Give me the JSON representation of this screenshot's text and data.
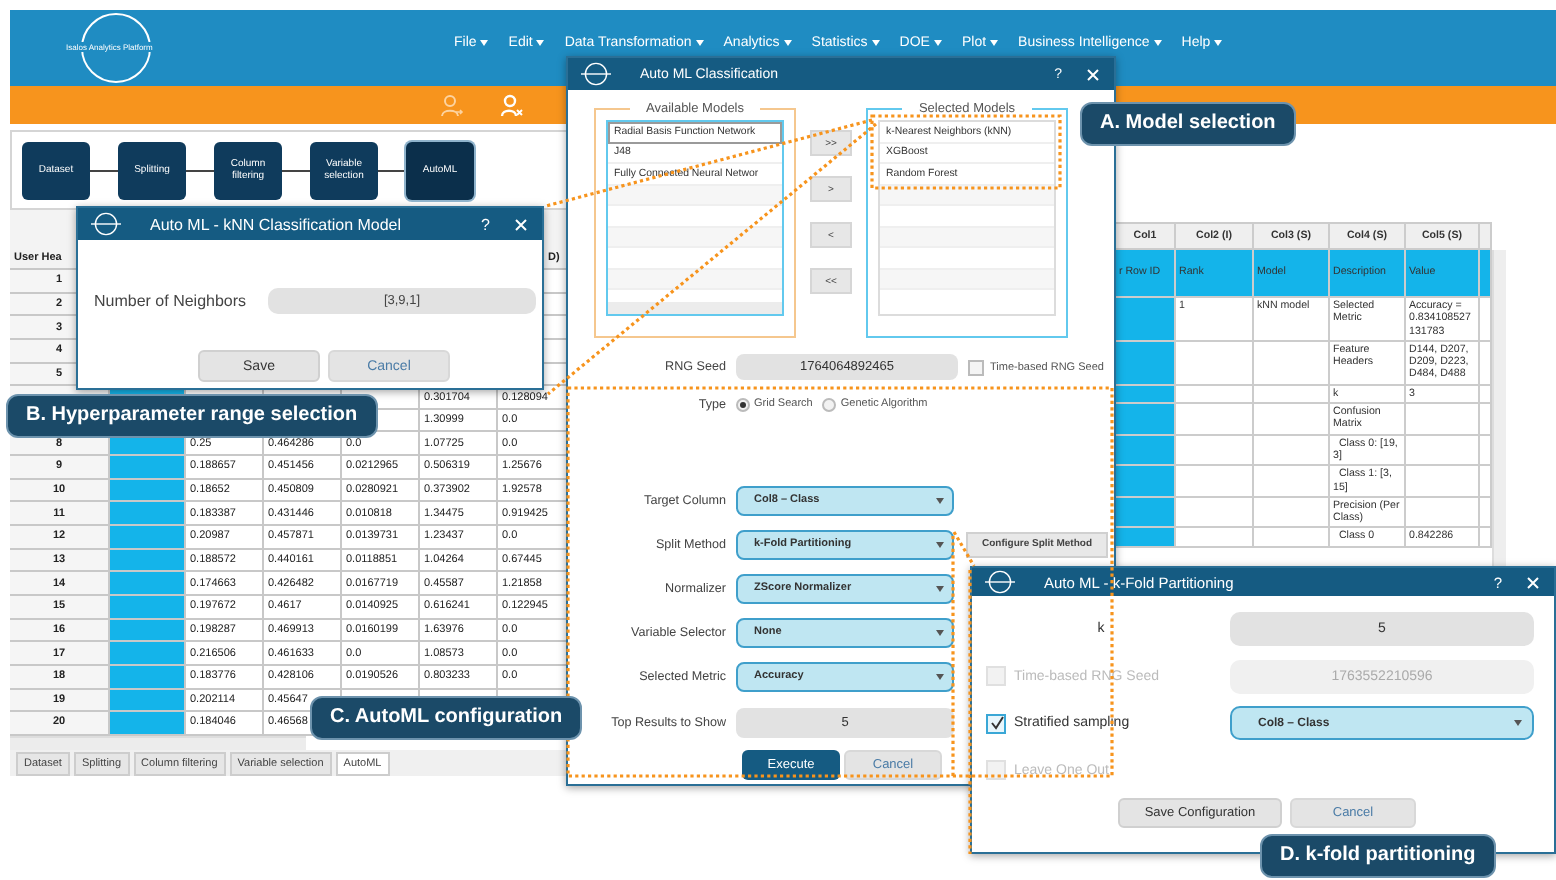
{
  "app": {
    "logo_text": "Isalos Analytics Platform",
    "menu": [
      {
        "label": "File"
      },
      {
        "label": "Edit"
      },
      {
        "label": "Data Transformation"
      },
      {
        "label": "Analytics"
      },
      {
        "label": "Statistics"
      },
      {
        "label": "DOE"
      },
      {
        "label": "Plot"
      },
      {
        "label": "Business Intelligence"
      },
      {
        "label": "Help"
      }
    ],
    "workflow": [
      {
        "label": "Dataset",
        "selected": false
      },
      {
        "label": "Splitting",
        "selected": false
      },
      {
        "label": "Column filtering",
        "selected": false
      },
      {
        "label": "Variable selection",
        "selected": false
      },
      {
        "label": "AutoML",
        "selected": true
      }
    ],
    "table": {
      "corner": "User Hea",
      "column_5_header": "D)",
      "rows": [
        {
          "label": "1"
        },
        {
          "label": "2"
        },
        {
          "label": "3"
        },
        {
          "label": "4"
        },
        {
          "label": "5"
        },
        {
          "cells": [
            null,
            null,
            null,
            "0.301704",
            "0.128094"
          ]
        },
        {
          "cells": [
            null,
            null,
            null,
            "1.30999",
            "0.0"
          ]
        },
        {
          "label": "8",
          "cells": [
            "0.25",
            "0.464286",
            "0.0",
            "1.07725",
            "0.0"
          ]
        },
        {
          "label": "9",
          "cells": [
            "0.188657",
            "0.451456",
            "0.0212965",
            "0.506319",
            "1.25676"
          ]
        },
        {
          "label": "10",
          "cells": [
            "0.18652",
            "0.450809",
            "0.0280921",
            "0.373902",
            "1.92578"
          ]
        },
        {
          "label": "11",
          "cells": [
            "0.183387",
            "0.431446",
            "0.010818",
            "1.34475",
            "0.919425"
          ]
        },
        {
          "label": "12",
          "cells": [
            "0.20987",
            "0.457871",
            "0.0139731",
            "1.23437",
            "0.0"
          ]
        },
        {
          "label": "13",
          "cells": [
            "0.188572",
            "0.440161",
            "0.0118851",
            "1.04264",
            "0.67445"
          ]
        },
        {
          "label": "14",
          "cells": [
            "0.174663",
            "0.426482",
            "0.0167719",
            "0.45587",
            "1.21858"
          ]
        },
        {
          "label": "15",
          "cells": [
            "0.197672",
            "0.4617",
            "0.0140925",
            "0.616241",
            "0.122945"
          ]
        },
        {
          "label": "16",
          "cells": [
            "0.198287",
            "0.469913",
            "0.0160199",
            "1.63976",
            "0.0"
          ]
        },
        {
          "label": "17",
          "cells": [
            "0.216506",
            "0.461633",
            "0.0",
            "1.08573",
            "0.0"
          ]
        },
        {
          "label": "18",
          "cells": [
            "0.183776",
            "0.428106",
            "0.0190526",
            "0.803233",
            "0.0"
          ]
        },
        {
          "label": "19",
          "cells": [
            "0.202114",
            "0.45647",
            null,
            null,
            null
          ]
        },
        {
          "label": "20",
          "cells": [
            "0.184046",
            "0.46568",
            null,
            null,
            null
          ]
        }
      ]
    },
    "bottom_tabs": [
      {
        "label": "Dataset",
        "selected": false
      },
      {
        "label": "Splitting",
        "selected": false
      },
      {
        "label": "Column filtering",
        "selected": false
      },
      {
        "label": "Variable selection",
        "selected": false
      },
      {
        "label": "AutoML",
        "selected": true
      }
    ]
  },
  "right_table": {
    "columns": [
      "Col1",
      "Col2 (I)",
      "Col3 (S)",
      "Col4 (S)",
      "Col5 (S)"
    ],
    "header_row": [
      "r Row ID",
      "Rank",
      "Model",
      "Description",
      "Value"
    ],
    "rows": [
      [
        null,
        "1",
        "kNN model",
        "Selected Metric",
        "Accuracy = 0.834108527131783"
      ],
      [
        null,
        null,
        null,
        "Feature Headers",
        "D144, D207, D209, D223, D484, D488"
      ],
      [
        null,
        null,
        null,
        "k",
        "3"
      ],
      [
        null,
        null,
        null,
        "Confusion Matrix",
        null
      ],
      [
        null,
        null,
        null,
        "  Class 0: [19, 3]",
        null
      ],
      [
        null,
        null,
        null,
        "  Class 1: [3, 15]",
        null
      ],
      [
        null,
        null,
        null,
        "Precision (Per Class)",
        null
      ],
      [
        null,
        null,
        null,
        "  Class 0",
        "0.842286"
      ]
    ]
  },
  "classification_dialog": {
    "title": "Auto ML Classification",
    "help": "?",
    "available_models": {
      "legend": "Available Models",
      "items": [
        {
          "label": "Radial Basis Function Network",
          "selected": true
        },
        {
          "label": "J48",
          "selected": false
        },
        {
          "label": "Fully Connected Neural Networ",
          "selected": false
        }
      ]
    },
    "transfer_buttons": [
      ">>",
      ">",
      "<",
      "<<"
    ],
    "selected_models": {
      "legend": "Selected Models",
      "items": [
        {
          "label": "k-Nearest Neighbors (kNN)",
          "selected": false
        },
        {
          "label": "XGBoost",
          "selected": false
        },
        {
          "label": "Random Forest",
          "selected": false
        }
      ]
    },
    "rng_seed": {
      "label": "RNG Seed",
      "value": "1764064892465"
    },
    "time_based_seed": {
      "label": "Time-based RNG Seed",
      "checked": false
    },
    "type": {
      "label": "Type",
      "options": [
        {
          "label": "Grid Search",
          "selected": true
        },
        {
          "label": "Genetic Algorithm",
          "selected": false
        }
      ]
    },
    "settings": [
      {
        "label": "Target Column",
        "value": "Col8 – Class"
      },
      {
        "label": "Split Method",
        "value": "k-Fold Partitioning",
        "button": "Configure Split Method"
      },
      {
        "label": "Normalizer",
        "value": "ZScore Normalizer"
      },
      {
        "label": "Variable Selector",
        "value": "None"
      },
      {
        "label": "Selected Metric",
        "value": "Accuracy"
      }
    ],
    "top_results": {
      "label": "Top Results to Show",
      "value": "5"
    },
    "buttons": [
      {
        "label": "Execute",
        "kind": "primary"
      },
      {
        "label": "Cancel",
        "kind": "cancel"
      }
    ]
  },
  "knn_dialog": {
    "title": "Auto ML - kNN Classification Model",
    "help": "?",
    "field": {
      "label": "Number of Neighbors",
      "value": "[3,9,1]"
    },
    "buttons": [
      {
        "label": "Save",
        "kind": "save"
      },
      {
        "label": "Cancel",
        "kind": "cancel"
      }
    ]
  },
  "kfold_dialog": {
    "title": "Auto ML - k-Fold Partitioning",
    "help": "?",
    "k": {
      "label": "k",
      "value": "5"
    },
    "options": [
      {
        "kind": "field",
        "label": "Time-based RNG Seed",
        "checked": false,
        "disabled": true,
        "value": "1763552210596"
      },
      {
        "kind": "dropdown",
        "label": "Stratified sampling",
        "checked": true,
        "disabled": false,
        "value": "Col8 – Class"
      },
      {
        "kind": "plain",
        "label": "Leave One Out",
        "checked": false,
        "disabled": true
      }
    ],
    "buttons": [
      {
        "label": "Save Configuration",
        "kind": "save"
      },
      {
        "label": "Cancel",
        "kind": "cancel"
      }
    ]
  },
  "callouts": [
    {
      "label": "A. Model selection"
    },
    {
      "label": "B. Hyperparameter range selection"
    },
    {
      "label": "C. AutoML configuration"
    },
    {
      "label": "D. k-fold partitioning"
    }
  ]
}
